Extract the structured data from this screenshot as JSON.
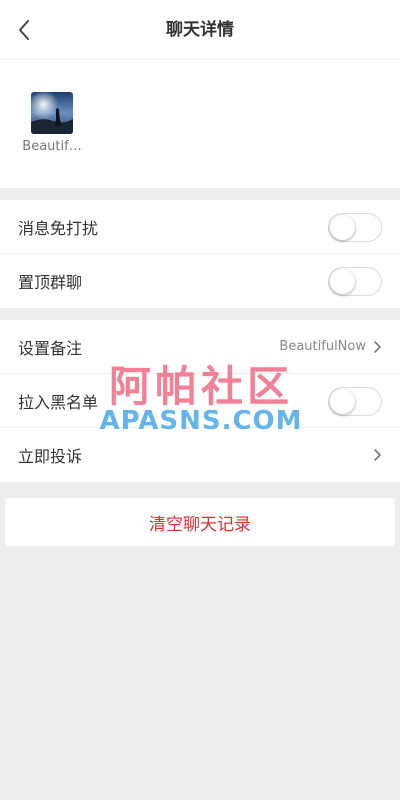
{
  "header": {
    "title": "聊天详情",
    "back_icon": "chevron-left-icon"
  },
  "members": [
    {
      "name": "Beautif…",
      "avatar": "landscape-avatar"
    }
  ],
  "settings": {
    "mute_label": "消息免打扰",
    "mute_on": false,
    "pin_label": "置顶群聊",
    "pin_on": false
  },
  "profile": {
    "remark_label": "设置备注",
    "remark_value": "BeautifulNow",
    "blacklist_label": "拉入黑名单",
    "blacklist_on": false,
    "report_label": "立即投诉"
  },
  "actions": {
    "clear_label": "清空聊天记录"
  },
  "watermark": {
    "cn": "阿帕社区",
    "en": "APASNS.COM"
  },
  "colors": {
    "danger": "#e03030",
    "background": "#ededed",
    "watermark_pink": "#f26b83",
    "watermark_blue": "#4aa9e8"
  }
}
